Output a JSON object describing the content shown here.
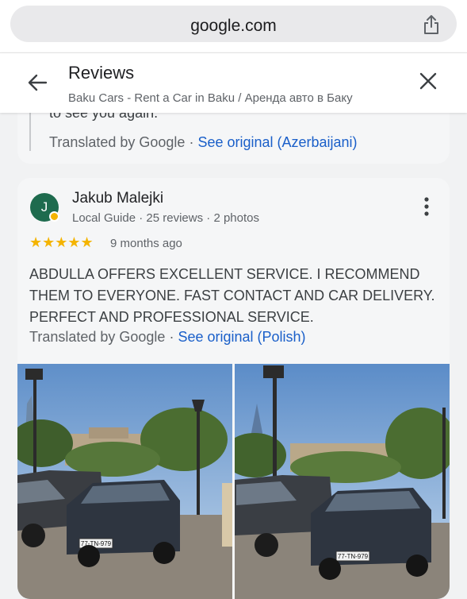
{
  "browser": {
    "url": "google.com"
  },
  "header": {
    "title": "Reviews",
    "subtitle": "Baku Cars - Rent a Car in Baku / Аренда авто в Баку"
  },
  "previous_review": {
    "cut_text": "to see you again.",
    "translated_by": "Translated by Google",
    "separator": " · ",
    "see_original": "See original (Azerbaijani)"
  },
  "review": {
    "avatar_letter": "J",
    "author": "Jakub Malejki",
    "local_guide": "Local Guide",
    "separator": " · ",
    "reviews_count": "25 reviews",
    "photos_count": "2 photos",
    "stars": "★★★★★",
    "rating": 5,
    "time": "9 months ago",
    "text": "ABDULLA OFFERS EXCELLENT SERVICE. I RECOMMEND THEM TO EVERYONE. FAST CONTACT AND CAR DELIVERY. PERFECT AND PROFESSIONAL SERVICE.",
    "translated_by": "Translated by Google",
    "see_original": "See original (Polish)",
    "photo_plates": [
      "77-TN-979",
      "77-TN-979"
    ]
  },
  "colors": {
    "link": "#1a5fc9",
    "star": "#f4b400",
    "avatar": "#1e6b4e"
  },
  "icons": {
    "share": "share-icon",
    "back": "back-arrow-icon",
    "close": "close-icon",
    "more": "more-vertical-icon"
  }
}
